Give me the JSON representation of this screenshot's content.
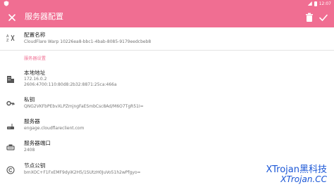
{
  "app_bar": {
    "title": "服务器配置"
  },
  "status_bar": {
    "time": "12:07"
  },
  "config_name": {
    "label": "配置名称",
    "value": "CloudFlare Warp 10226ea8-bbc1-4bab-8085-9179eedcbeb8"
  },
  "section": {
    "title": "服务器设置"
  },
  "local_address": {
    "label": "本地地址",
    "value_v4": "172.16.0.2",
    "value_v6": "2606:4700:110:80d8:2b32:8871:25ca:466a"
  },
  "private_key": {
    "label": "私钥",
    "value": "QNG2VKFbPEbvXLPZmjngFaESmbCsc8Ad/M6O7TgR51I="
  },
  "server": {
    "label": "服务器",
    "value": "engage.cloudflareclient.com"
  },
  "server_port": {
    "label": "服务器端口",
    "value": "2408"
  },
  "public_key": {
    "label": "节点公钥",
    "value": "bmXOC+F1FxEMF9dyiK2H5/1SUtzH0JuVo51h2wPfgyo="
  },
  "watermark": {
    "line1": "XTrojan黑科技",
    "line2": "XTrojan.CC"
  },
  "colors": {
    "accent": "#f06e92"
  }
}
